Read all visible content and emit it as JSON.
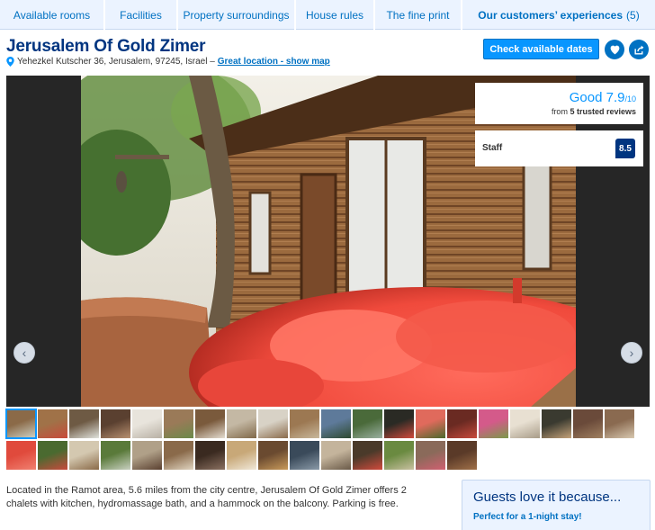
{
  "tabs": [
    {
      "label": "Available rooms"
    },
    {
      "label": "Facilities"
    },
    {
      "label": "Property surroundings"
    },
    {
      "label": "House rules"
    },
    {
      "label": "The fine print"
    },
    {
      "label": "Our customers’ experiences",
      "count": "(5)"
    }
  ],
  "property": {
    "name": "Jerusalem Of Gold Zimer",
    "address": "Yehezkel Kutscher 36, Jerusalem, 97245, Israel –",
    "map_link": "Great location - show map"
  },
  "actions": {
    "check_label": "Check available dates",
    "favorite_icon": "heart-icon",
    "share_icon": "share-icon"
  },
  "score": {
    "rating_word": "Good",
    "rating_value": "7.9",
    "rating_max": "/10",
    "reviews_prefix": "from",
    "reviews_count": "5 trusted reviews"
  },
  "staff": {
    "label": "Staff",
    "value": "8.5"
  },
  "gallery": {
    "prev_icon": "chevron-left-icon",
    "next_icon": "chevron-right-icon",
    "thumb_count": 35,
    "thumbs_row1": 20,
    "thumbs_row2": 15
  },
  "description": {
    "text": "Located in the Ramot area, 5.6 miles from the city centre, Jerusalem Of Gold Zimer offers 2 chalets with kitchen, hydromassage bath, and a hammock on the balcony. Parking is free."
  },
  "guests": {
    "title": "Guests love it because...",
    "subtitle": "Perfect for a 1-night stay!"
  },
  "colors": {
    "brand_dark": "#003580",
    "link_blue": "#0071c2",
    "button_blue": "#0896ff",
    "tab_bg": "#ebf3ff"
  }
}
